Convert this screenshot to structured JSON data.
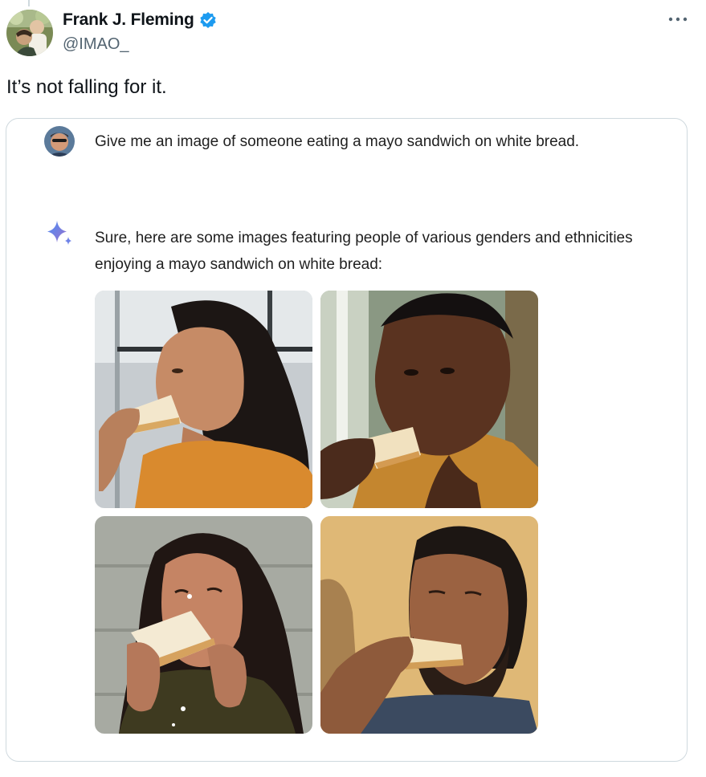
{
  "author": {
    "display_name": "Frank J. Fleming",
    "handle": "@IMAO_",
    "verified_icon": "verified-badge-icon",
    "avatar": "profile-avatar"
  },
  "more_icon": "more-options-icon",
  "tweet": {
    "text": "It’s not falling for it."
  },
  "embedded_chat": {
    "user_prompt": "Give me an image of someone eating a mayo sandwich on white bread.",
    "assistant_icon": "gemini-sparkle-icon",
    "assistant_reply": "Sure, here are some images featuring people of various genders and ethnicities enjoying a mayo sandwich on white bread:",
    "images": [
      {
        "subject": "woman-eating-sandwich-photo"
      },
      {
        "subject": "man-eating-sandwich-photo"
      },
      {
        "subject": "woman-biting-sandwich-photo"
      },
      {
        "subject": "bearded-man-eating-sandwich-photo"
      }
    ]
  },
  "colors": {
    "text": "#0f1419",
    "secondary_text": "#536471",
    "verified_blue": "#1d9bf0",
    "card_border": "#cfd9de"
  }
}
